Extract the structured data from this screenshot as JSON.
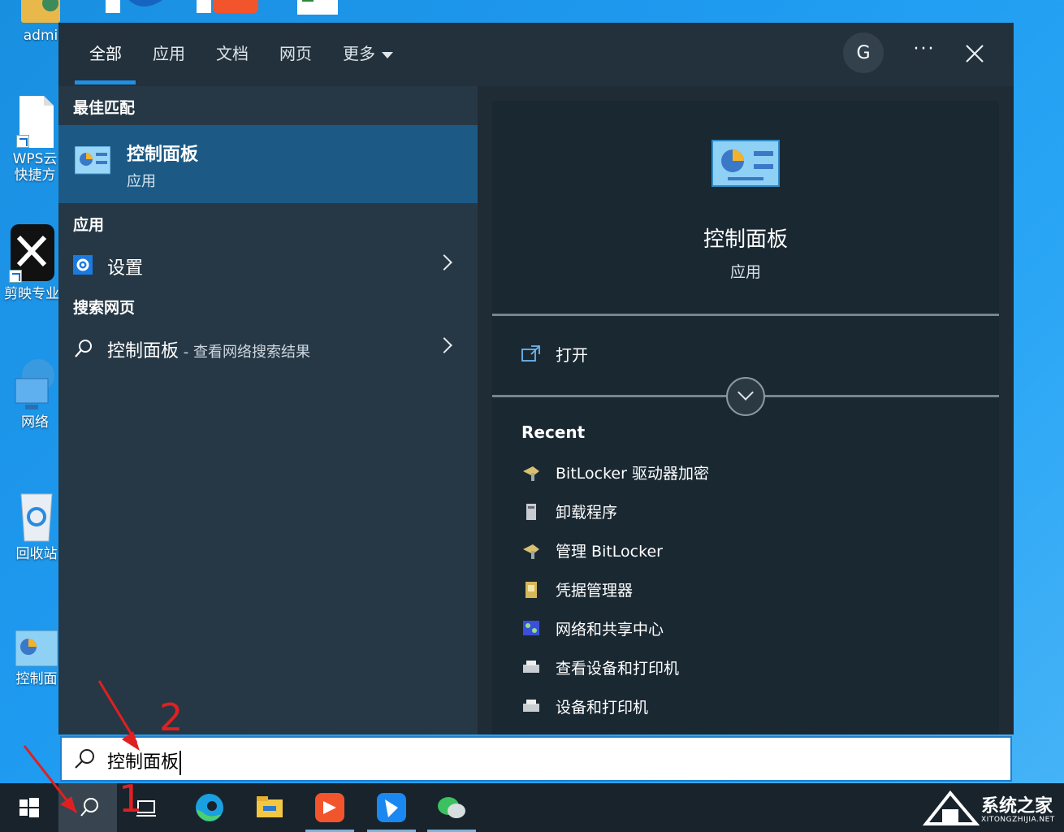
{
  "desktop": {
    "icons": [
      {
        "label": "admi"
      },
      {
        "label": "WPS云\n快捷方"
      },
      {
        "label": "剪映专业"
      },
      {
        "label": "网络"
      },
      {
        "label": "回收站"
      },
      {
        "label": "控制面"
      }
    ]
  },
  "search_panel": {
    "tabs": [
      {
        "label": "全部"
      },
      {
        "label": "应用"
      },
      {
        "label": "文档"
      },
      {
        "label": "网页"
      },
      {
        "label": "更多"
      }
    ],
    "avatar_letter": "G",
    "more_dots": "···",
    "best_match_title": "最佳匹配",
    "best_match": {
      "name": "控制面板",
      "type": "应用"
    },
    "apps_title": "应用",
    "apps": [
      {
        "label": "设置"
      }
    ],
    "web_title": "搜索网页",
    "web": {
      "label": "控制面板",
      "hint": " - 查看网络搜索结果"
    },
    "preview": {
      "name": "控制面板",
      "type": "应用",
      "open_label": "打开",
      "recent_title": "Recent",
      "recent": [
        {
          "label": "BitLocker 驱动器加密"
        },
        {
          "label": "卸载程序"
        },
        {
          "label": "管理 BitLocker"
        },
        {
          "label": "凭据管理器"
        },
        {
          "label": "网络和共享中心"
        },
        {
          "label": "查看设备和打印机"
        },
        {
          "label": "设备和打印机"
        }
      ]
    }
  },
  "search_box": {
    "value": "控制面板"
  },
  "annotations": {
    "step1": "1",
    "step2": "2"
  },
  "watermark": {
    "main": "系统之家",
    "sub": "XITONGZHIJIA.NET"
  },
  "colors": {
    "accent": "#1e90e6",
    "selection": "#1c5a85",
    "annotation": "#e02020"
  }
}
